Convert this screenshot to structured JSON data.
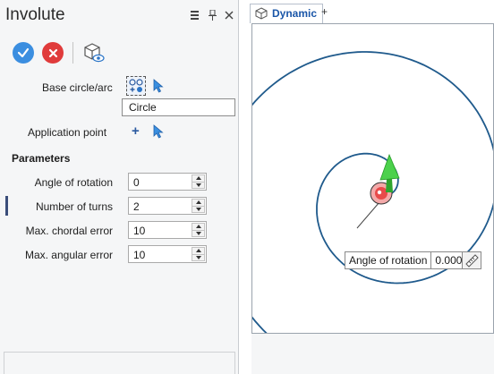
{
  "panel": {
    "title": "Involute",
    "toolbar": {
      "ok_icon": "check-icon",
      "cancel_icon": "close-icon",
      "view_icon": "cube-eye-icon"
    },
    "base_label": "Base circle/arc",
    "base_value": "Circle",
    "app_point_label": "Application point",
    "parameters_title": "Parameters",
    "params": [
      {
        "label": "Angle of rotation",
        "value": "0"
      },
      {
        "label": "Number of turns",
        "value": "2"
      },
      {
        "label": "Max. chordal error",
        "value": "10"
      },
      {
        "label": "Max. angular error",
        "value": "10"
      }
    ]
  },
  "viewport": {
    "tab_label": "Dynamic",
    "tab_add": "+",
    "angle_tooltip": {
      "label": "Angle of rotation",
      "value": "0.000"
    }
  },
  "colors": {
    "accent": "#3b8ee0",
    "cancel": "#e03b3b",
    "spiral": "#1f5a8c",
    "arrow": "#3ec23e",
    "point": "#e84a4a"
  }
}
